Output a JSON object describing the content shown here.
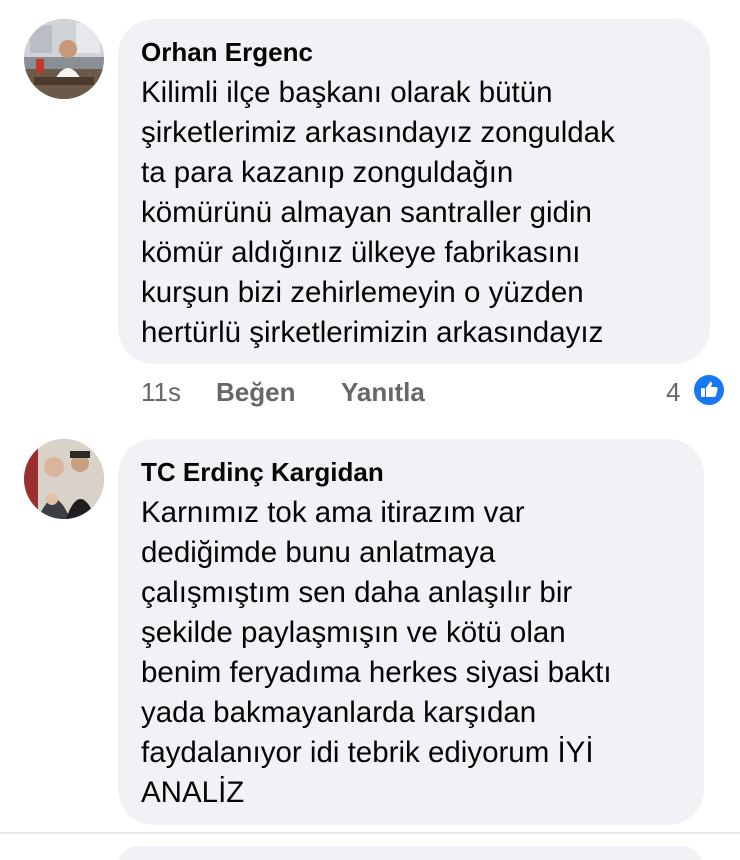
{
  "comments": [
    {
      "author": "Orhan Ergenc",
      "lines": [
        "Kilimli ilçe başkanı olarak bütün",
        "şirketlerimiz arkasındayız zonguldak",
        "ta para kazanıp zonguldağın",
        "kömürünü almayan santraller gidin",
        "kömür aldığınız ülkeye fabrikasını",
        "kurşun bizi zehirlemeyin o yüzden",
        "hertürlü şirketlerimizin arkasındayız"
      ],
      "time": "11s",
      "like_label": "Beğen",
      "reply_label": "Yanıtla",
      "reaction_count": "4"
    },
    {
      "author": "TC Erdinç Kargidan",
      "lines": [
        "Karnımız tok ama itirazım var",
        "dediğimde bunu anlatmaya",
        "çalışmıştım sen daha anlaşılır bir",
        "şekilde paylaşmışın ve kötü olan",
        "benim feryadıma herkes siyasi baktı",
        "yada bakmayanlarda karşıdan",
        "faydalanıyor idi tebrik ediyorum İYİ",
        "ANALİZ"
      ]
    }
  ],
  "colors": {
    "bubble": "#f0f2f5",
    "text": "#050505",
    "meta": "#65676b",
    "like_blue": "#1877f2"
  },
  "icons": {
    "reaction": "like-thumbs-up-icon"
  }
}
